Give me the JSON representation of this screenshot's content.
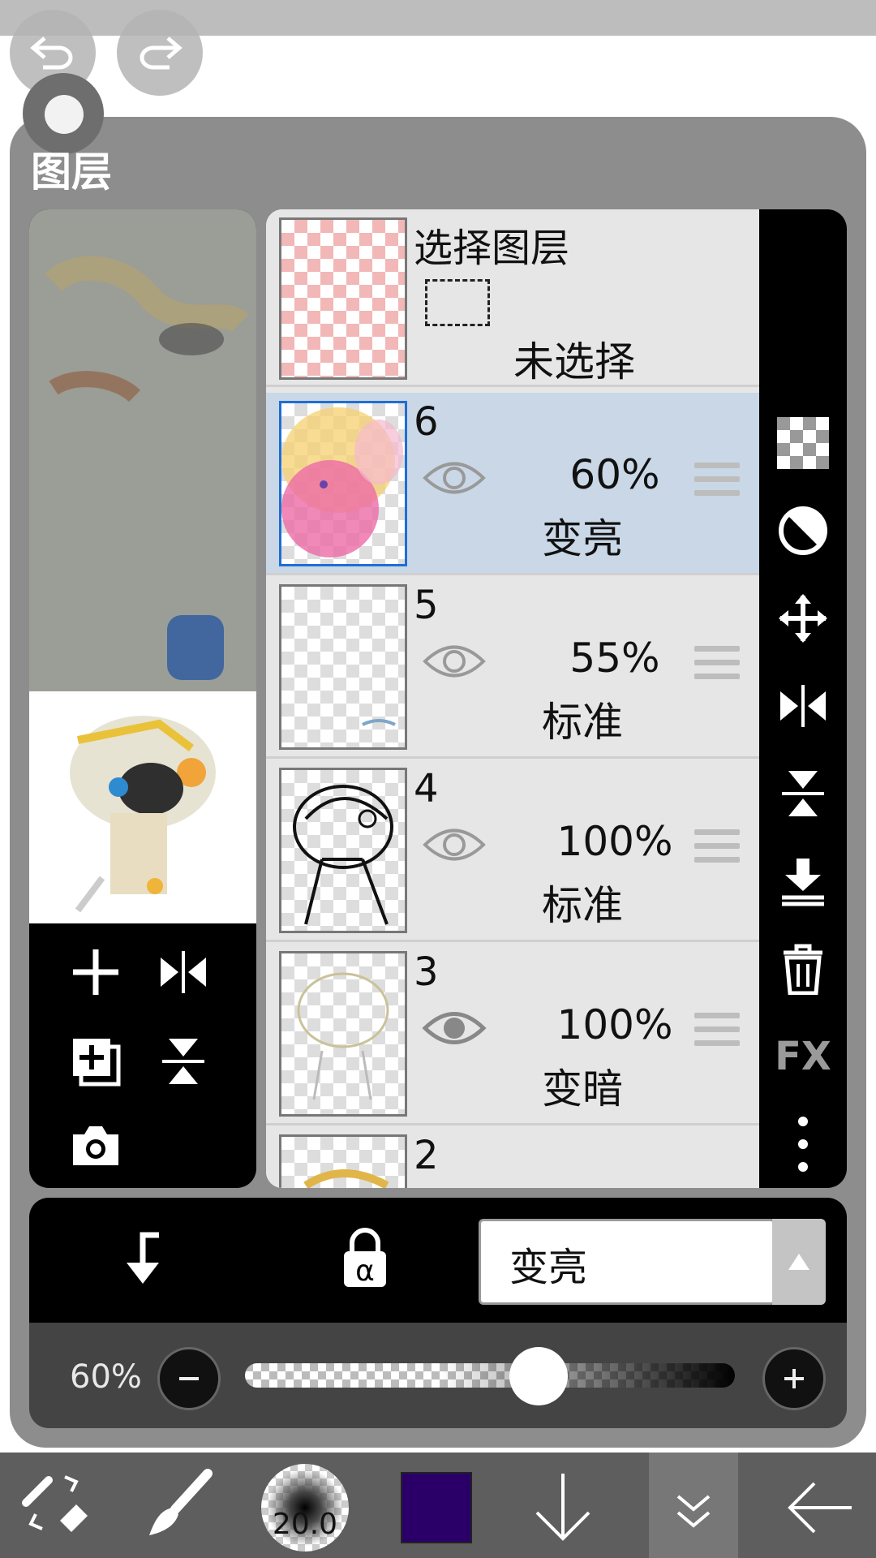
{
  "panel": {
    "title": "图层"
  },
  "selection_row": {
    "name": "选择图层",
    "status": "未选择"
  },
  "layers": [
    {
      "name": "6",
      "opacity": "60%",
      "mode": "变亮",
      "selected": true
    },
    {
      "name": "5",
      "opacity": "55%",
      "mode": "标准"
    },
    {
      "name": "4",
      "opacity": "100%",
      "mode": "标准"
    },
    {
      "name": "3",
      "opacity": "100%",
      "mode": "变暗"
    },
    {
      "name": "2"
    }
  ],
  "blend": {
    "value": "变亮"
  },
  "opacity_control": {
    "label": "60%",
    "level": 0.6
  },
  "brush": {
    "size": "20.0"
  },
  "colors": {
    "current": "#2a0068",
    "selection_border": "#1f6ed4"
  },
  "right_toolbar": {
    "fx_label": "FX"
  }
}
